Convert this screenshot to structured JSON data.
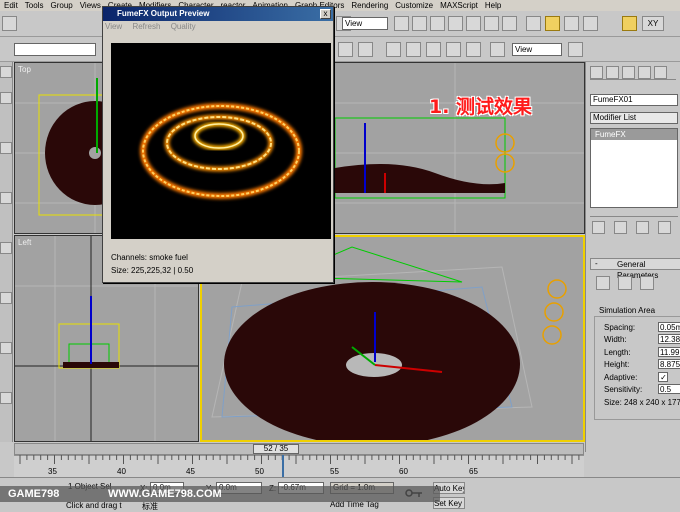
{
  "menubar": [
    "Edit",
    "Tools",
    "Group",
    "Views",
    "Create",
    "Modifiers",
    "Character",
    "reactor",
    "Animation",
    "Graph Editors",
    "Rendering",
    "Customize",
    "MAXScript",
    "Help"
  ],
  "toolbar": {
    "view_dropdown": "View",
    "view_dropdown2": "View",
    "xy_label": "XY"
  },
  "viewports": {
    "top": "Top",
    "left": "Left"
  },
  "annotation": "1. 测试效果",
  "fumefx_window": {
    "title": "FumeFX Output Preview",
    "menu": [
      "View",
      "Refresh",
      "Quality"
    ],
    "channels": "Channels: smoke fuel",
    "size": "Size: 225,225,32 | 0.50",
    "close": "x"
  },
  "command_panel": {
    "object_name": "FumeFX01",
    "modifier_list": "Modifier List",
    "stack_item": "FumeFX",
    "rollout_title": "General Parameters",
    "rollout_toggle": "-",
    "group_label": "Simulation Area",
    "params": [
      {
        "label": "Spacing:",
        "value": "0.05m"
      },
      {
        "label": "Width:",
        "value": "12.38"
      },
      {
        "label": "Length:",
        "value": "11.99"
      },
      {
        "label": "Height:",
        "value": "8.875"
      },
      {
        "label": "Adaptive:",
        "value": "✓"
      },
      {
        "label": "Sensitivity:",
        "value": "0.5"
      }
    ],
    "size_text": "Size:  248 x 240 x 177"
  },
  "timeline": {
    "frame_label": "52 / 35",
    "ticks": [
      "35",
      "40",
      "45",
      "50",
      "55",
      "60",
      "65"
    ]
  },
  "statusbar": {
    "object_selected": "1 Object Sel",
    "prompt": "Click and drag t",
    "x_label": "X:",
    "x_value": "0.0m",
    "y_label": "Y:",
    "y_value": "0.0m",
    "z_label": "Z:",
    "z_value": "-0.67m",
    "grid": "Grid = 1.0m",
    "auto_key": "Auto Key",
    "set_key": "Set Key",
    "add_time_tag": "Add Time Tag",
    "cn_label": "标准"
  },
  "watermark": {
    "left": "GAME798",
    "right": "WWW.GAME798.COM"
  },
  "colors": {
    "accent": "#f0d000",
    "annotation": "#ff1a1a",
    "fire": "#ffb000"
  }
}
